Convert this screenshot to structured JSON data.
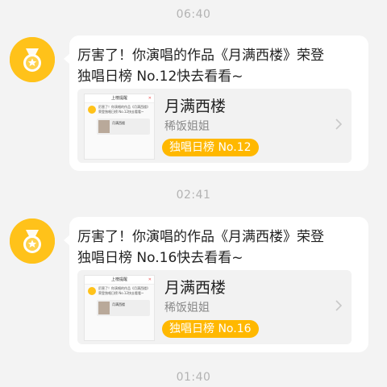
{
  "feed": {
    "messages": [
      {
        "time": "06:40",
        "text_line1": "厉害了！你演唱的作品《月满西楼》荣登",
        "text_line2": "独唱日榜 No.12快去看看~",
        "card": {
          "song_title": "月满西楼",
          "artist": "稀饭姐姐",
          "badge": "独唱日榜 No.12"
        }
      },
      {
        "time": "02:41",
        "text_line1": "厉害了！你演唱的作品《月满西楼》荣登",
        "text_line2": "独唱日榜 No.16快去看看~",
        "card": {
          "song_title": "月满西楼",
          "artist": "稀饭姐姐",
          "badge": "独唱日榜 No.16"
        }
      }
    ],
    "next_time": "01:40"
  },
  "thumbnail": {
    "bar_title": "上榜提醒",
    "body_text": "厉害了！你演唱的作品《月满西楼》荣登独唱日榜 No.12快去看看~",
    "card_title": "月满西楼"
  },
  "colors": {
    "accent": "#ffb800",
    "avatar": "#ffc21a",
    "background": "#f3f3f3",
    "timestamp": "#b3b3b3"
  },
  "icons": {
    "avatar": "medal-icon",
    "chevron": "chevron-right-icon"
  }
}
